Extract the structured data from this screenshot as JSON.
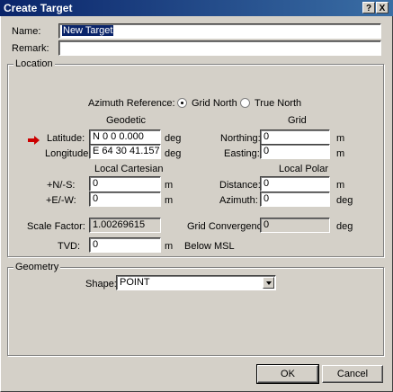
{
  "window": {
    "title": "Create Target",
    "help_label": "?",
    "close_label": "X"
  },
  "form": {
    "name_label": "Name:",
    "name_value": "New Target",
    "remark_label": "Remark:",
    "remark_value": ""
  },
  "location": {
    "group_title": "Location",
    "azimuth_label": "Azimuth Reference:",
    "grid_north_label": "Grid North",
    "true_north_label": "True North",
    "azimuth_selected": "Grid North",
    "geodetic_header": "Geodetic",
    "grid_header": "Grid",
    "latitude_label": "Latitude:",
    "latitude_value": "N 0 0 0.000",
    "longitude_label": "Longitude:",
    "longitude_value": "E 64 30 41.157",
    "deg_unit": "deg",
    "northing_label": "Northing:",
    "northing_value": "0",
    "easting_label": "Easting:",
    "easting_value": "0",
    "m_unit": "m",
    "local_cartesian_header": "Local Cartesian",
    "local_polar_header": "Local Polar",
    "ns_label": "+N/-S:",
    "ns_value": "0",
    "ew_label": "+E/-W:",
    "ew_value": "0",
    "distance_label": "Distance:",
    "distance_value": "0",
    "azimuth_field_label": "Azimuth:",
    "azimuth_value": "0",
    "scale_factor_label": "Scale Factor:",
    "scale_factor_value": "1.00269615",
    "grid_convergence_label": "Grid Convergence:",
    "grid_convergence_value": "0",
    "tvd_label": "TVD:",
    "tvd_value": "0",
    "below_msl_label": "Below MSL"
  },
  "geometry": {
    "group_title": "Geometry",
    "shape_label": "Shape:",
    "shape_value": "POINT"
  },
  "buttons": {
    "ok_label": "OK",
    "cancel_label": "Cancel"
  },
  "colors": {
    "dialog_bg": "#d4d0c8",
    "title_bar": "#0a246a",
    "arrow": "#cc0000"
  }
}
